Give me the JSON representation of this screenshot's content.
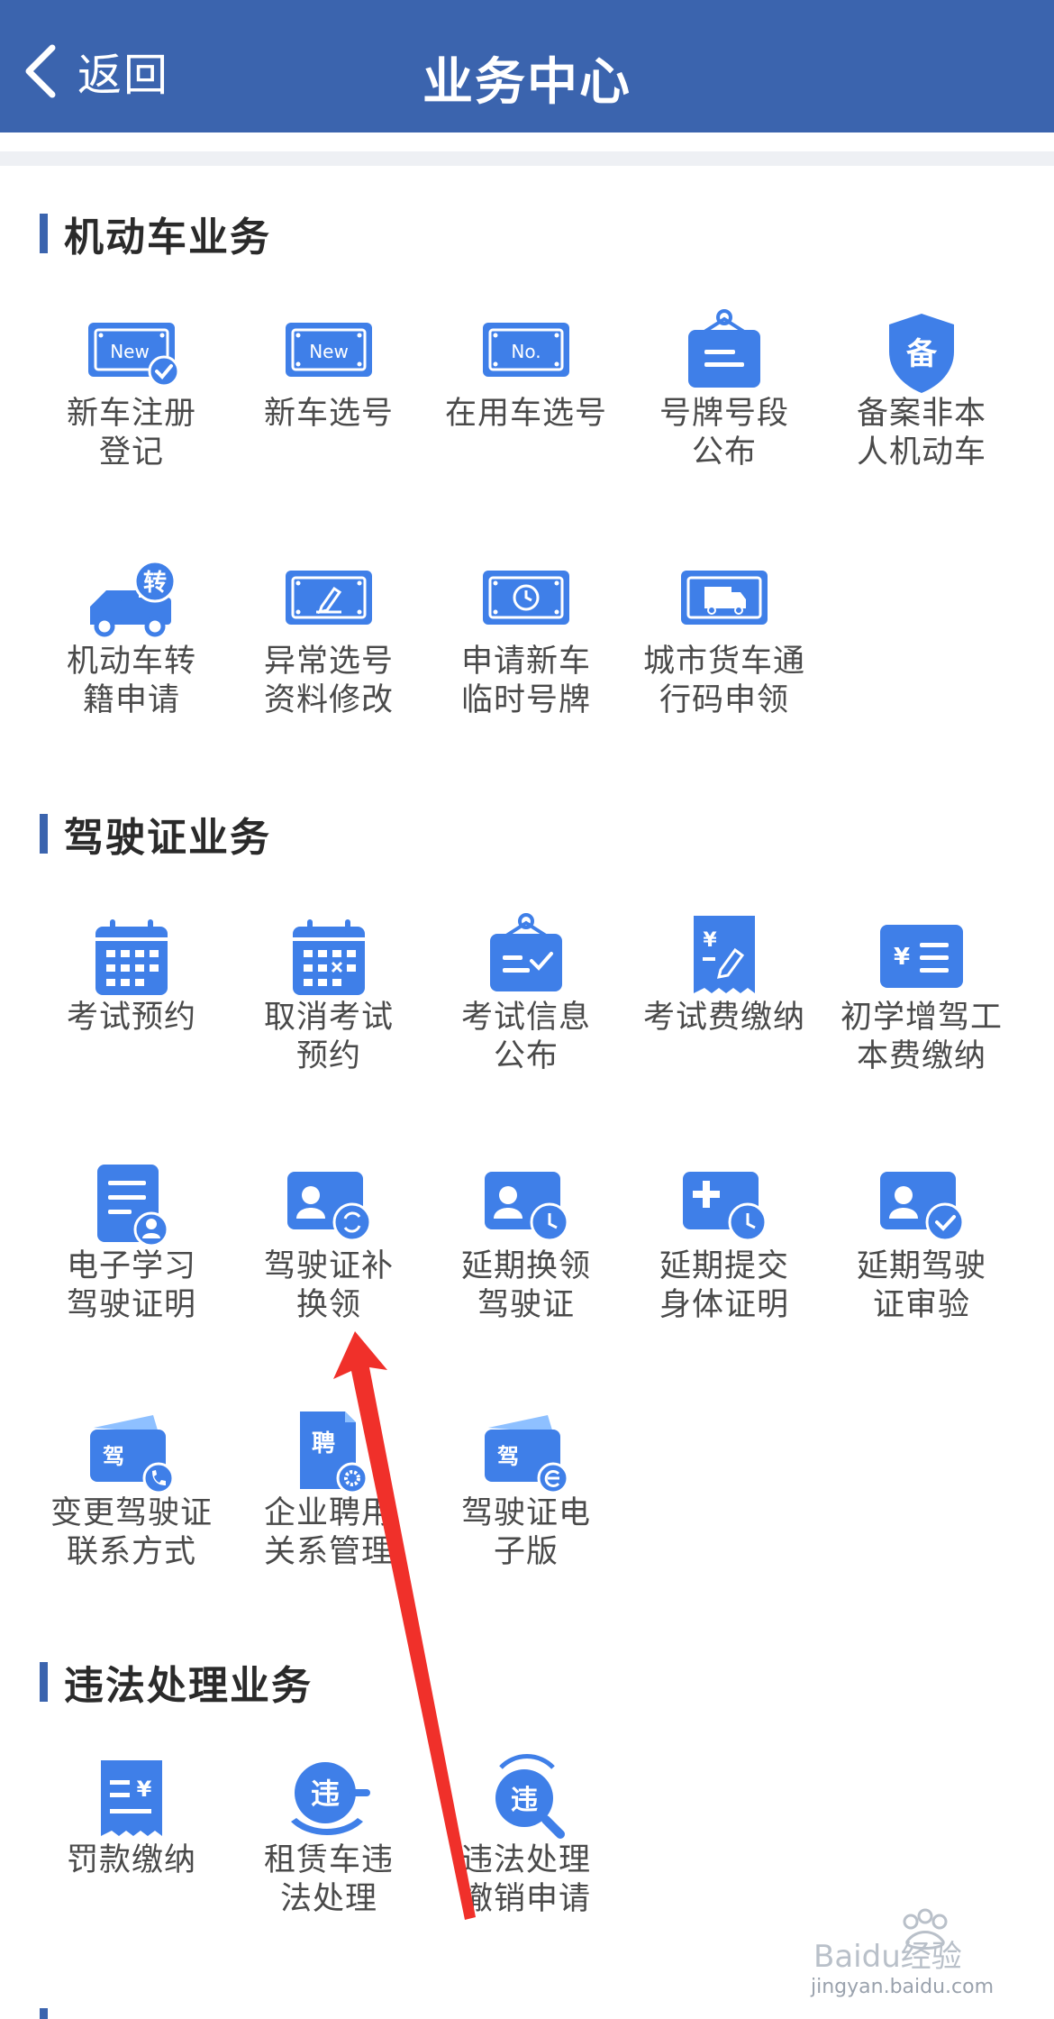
{
  "header": {
    "back_label": "返回",
    "title": "业务中心"
  },
  "sections": [
    {
      "title": "机动车业务",
      "items": [
        {
          "label": "新车注册\n登记",
          "icon": "new-plate-check-icon"
        },
        {
          "label": "新车选号",
          "icon": "new-plate-icon"
        },
        {
          "label": "在用车选号",
          "icon": "no-plate-icon"
        },
        {
          "label": "号牌号段\n公布",
          "icon": "plate-board-icon"
        },
        {
          "label": "备案非本\n人机动车",
          "icon": "record-shield-icon"
        },
        {
          "label": "机动车转\n籍申请",
          "icon": "truck-transfer-icon"
        },
        {
          "label": "异常选号\n资料修改",
          "icon": "plate-edit-icon"
        },
        {
          "label": "申请新车\n临时号牌",
          "icon": "plate-clock-icon"
        },
        {
          "label": "城市货车通\n行码申领",
          "icon": "truck-pass-icon"
        }
      ]
    },
    {
      "title": "驾驶证业务",
      "items": [
        {
          "label": "考试预约",
          "icon": "calendar-icon"
        },
        {
          "label": "取消考试\n预约",
          "icon": "calendar-cancel-icon"
        },
        {
          "label": "考试信息\n公布",
          "icon": "exam-board-icon"
        },
        {
          "label": "考试费缴纳",
          "icon": "fee-receipt-icon"
        },
        {
          "label": "初学增驾工\n本费缴纳",
          "icon": "cost-list-icon"
        },
        {
          "label": "电子学习\n驾驶证明",
          "icon": "study-doc-icon"
        },
        {
          "label": "驾驶证补\n换领",
          "icon": "license-renew-icon"
        },
        {
          "label": "延期换领\n驾驶证",
          "icon": "license-clock-icon"
        },
        {
          "label": "延期提交\n身体证明",
          "icon": "medical-clock-icon"
        },
        {
          "label": "延期驾驶\n证审验",
          "icon": "license-check-icon"
        },
        {
          "label": "变更驾驶证\n联系方式",
          "icon": "contact-phone-icon",
          "badge": "驾"
        },
        {
          "label": "企业聘用\n关系管理",
          "icon": "hire-gear-icon",
          "badge": "聘"
        },
        {
          "label": "驾驶证电\n子版",
          "icon": "e-license-icon",
          "badge": "驾"
        }
      ]
    },
    {
      "title": "违法处理业务",
      "items": [
        {
          "label": "罚款缴纳",
          "icon": "fine-receipt-icon"
        },
        {
          "label": "租赁车违\n法处理",
          "icon": "rental-violation-icon",
          "badge": "违"
        },
        {
          "label": "违法处理\n撤销申请",
          "icon": "violation-search-icon",
          "badge": "违"
        }
      ]
    },
    {
      "title": ""
    }
  ],
  "icon_badges": {
    "plate_new": "New",
    "plate_no": "No.",
    "record": "备",
    "transfer": "转",
    "yen": "¥"
  },
  "colors": {
    "header": "#3b64ae",
    "icon_primary": "#3f7fe8",
    "icon_light": "#8ec0ff",
    "arrow": "#f0302a"
  },
  "watermark": {
    "brand": "Baidu经验",
    "url": "jingyan.baidu.com"
  }
}
